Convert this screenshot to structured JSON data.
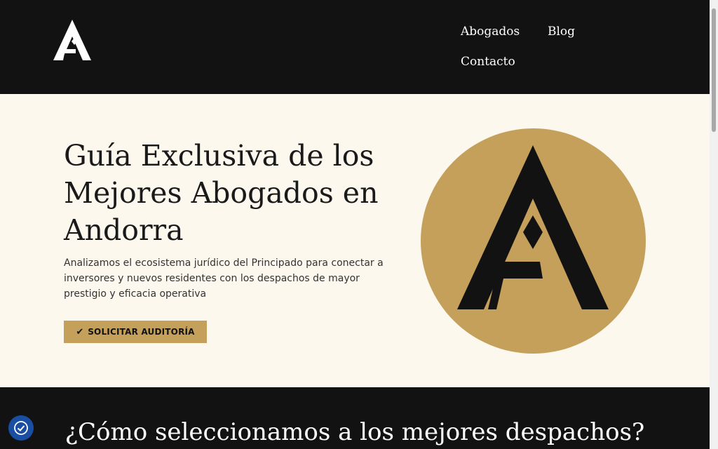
{
  "header": {
    "logo_icon": "a-monogram-logo",
    "nav": [
      {
        "label": "Abogados"
      },
      {
        "label": "Blog"
      },
      {
        "label": "Contacto"
      }
    ]
  },
  "hero": {
    "title": "Guía Exclusiva de los Mejores Abogados en Andorra",
    "subtitle": "Analizamos el ecosistema jurídico del Principado para conectar a inversores y nuevos residentes con los despachos de mayor prestigio y eficacia operativa",
    "cta": {
      "icon": "check-icon",
      "label": "SOLICITAR AUDITORÍA"
    },
    "emblem_icon": "a-monogram-emblem"
  },
  "section2": {
    "title": "¿Cómo seleccionamos a los mejores despachos?"
  },
  "widgets": {
    "accessibility_icon": "accessibility-icon"
  },
  "colors": {
    "dark": "#121212",
    "cream": "#fcf8ee",
    "gold": "#c4a05a",
    "accessibility_blue": "#1a4ea3"
  }
}
